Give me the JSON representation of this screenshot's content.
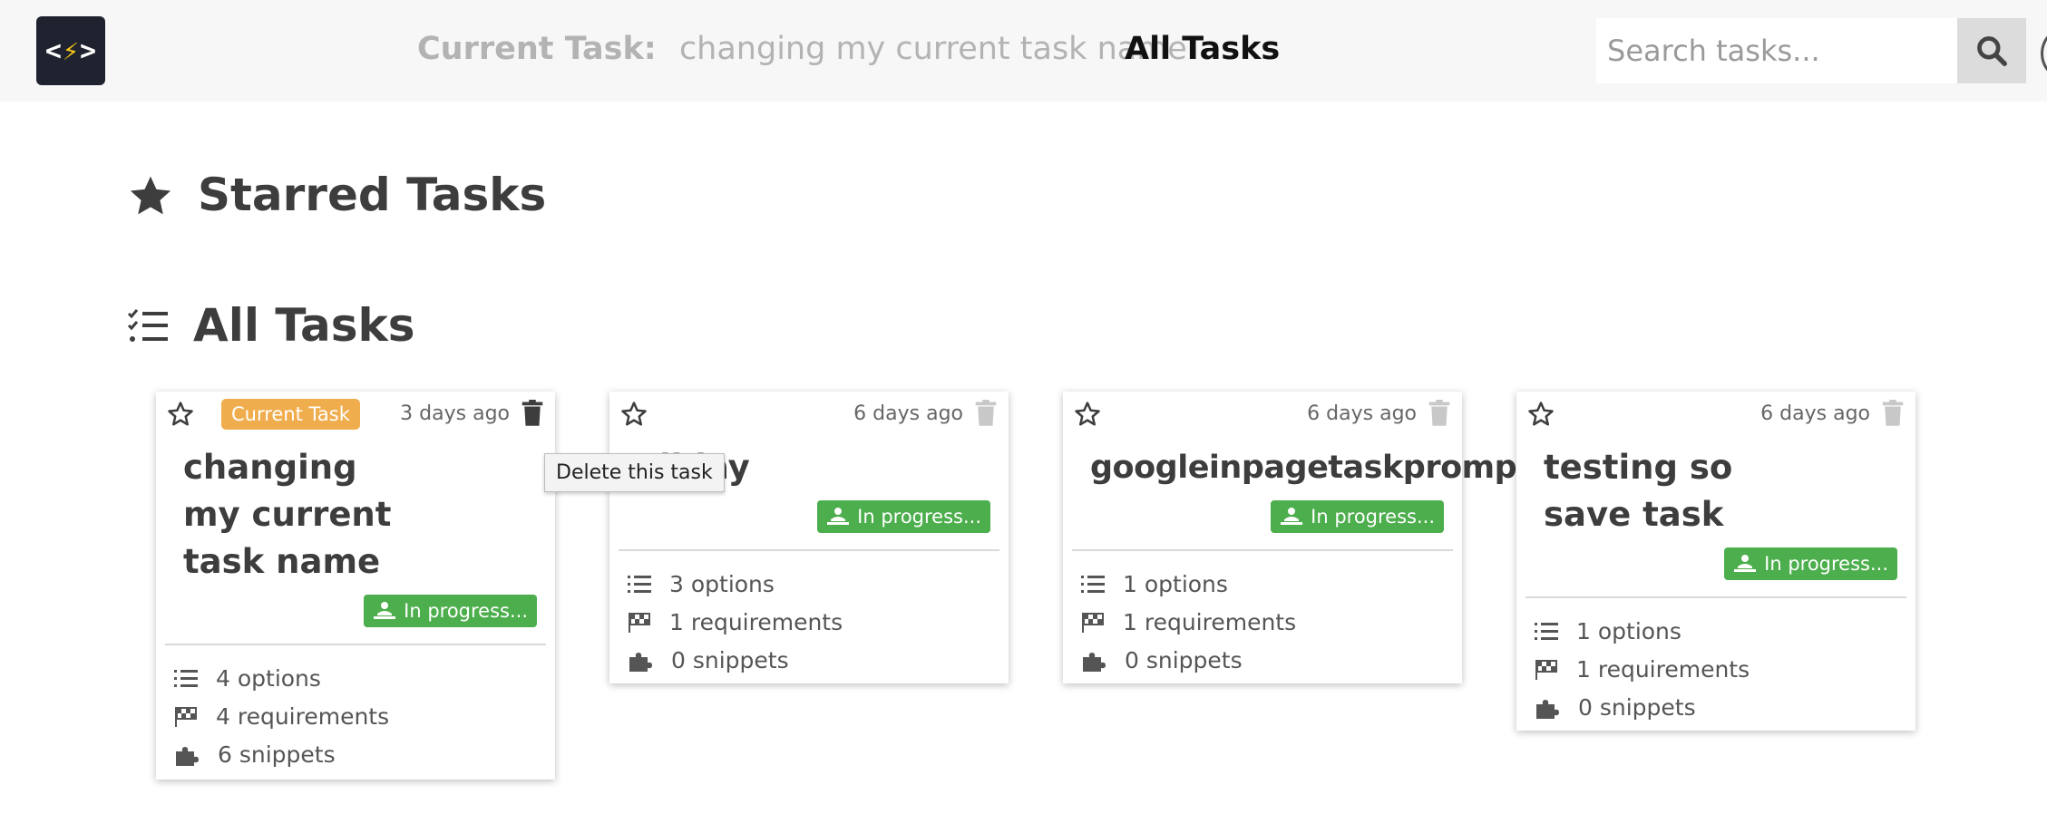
{
  "header": {
    "logo_left": "<",
    "logo_bolt": "⚡",
    "logo_right": ">",
    "current_task_label": "Current Task:",
    "current_task_name": "changing my current task name",
    "nav_all_tasks": "All Tasks",
    "search_placeholder": "Search tasks...",
    "search_icon": "search-icon"
  },
  "sections": {
    "starred_title": "Starred Tasks",
    "all_title": "All Tasks"
  },
  "tooltip": "Delete this task",
  "colors": {
    "header_bg": "#f7f7f7",
    "current_badge": "#f0ad4e",
    "status_green": "#4cae4c"
  },
  "tasks": [
    {
      "current_badge": "Current Task",
      "time": "3 days ago",
      "title": "changing my current task name",
      "status": "In progress...",
      "options": "4 options",
      "requirements": "4 requirements",
      "snippets": "6 snippets"
    },
    {
      "time": "6 days ago",
      "title": "allday",
      "status": "In progress...",
      "options": "3 options",
      "requirements": "1 requirements",
      "snippets": "0 snippets"
    },
    {
      "time": "6 days ago",
      "title": "googleinpagetaskprompt",
      "status": "In progress...",
      "options": "1 options",
      "requirements": "1 requirements",
      "snippets": "0 snippets"
    },
    {
      "time": "6 days ago",
      "title": "testing so save task",
      "status": "In progress...",
      "options": "1 options",
      "requirements": "1 requirements",
      "snippets": "0 snippets"
    }
  ]
}
